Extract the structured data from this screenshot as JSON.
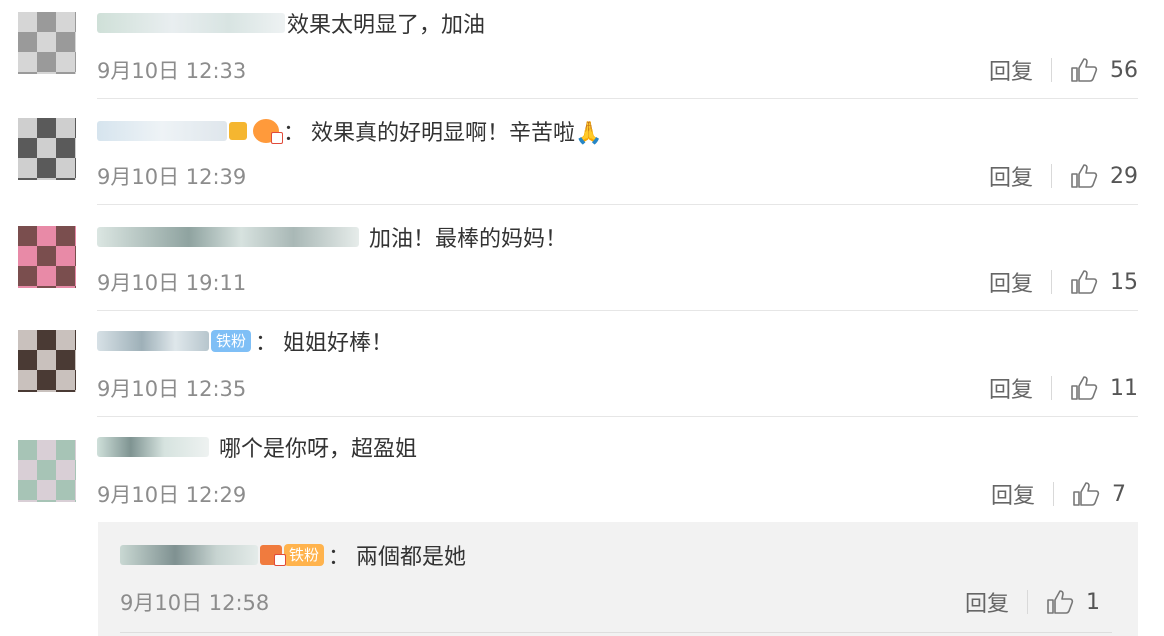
{
  "comments": [
    {
      "text": "效果太明显了，加油",
      "time": "9月10日 12:33",
      "reply": "回复",
      "likes": "56"
    },
    {
      "text": "效果真的好明显啊！辛苦啦🙏",
      "time": "9月10日 12:39",
      "reply": "回复",
      "likes": "29"
    },
    {
      "text": "加油！最棒的妈妈！",
      "time": "9月10日 19:11",
      "reply": "回复",
      "likes": "15"
    },
    {
      "text": "姐姐好棒！",
      "badge": "铁粉",
      "time": "9月10日 12:35",
      "reply": "回复",
      "likes": "11"
    },
    {
      "text": "哪个是你呀，超盈姐",
      "time": "9月10日 12:29",
      "reply": "回复",
      "likes": "7"
    }
  ],
  "sub_reply": {
    "text": "兩個都是她",
    "badge": "铁粉",
    "time": "9月10日 12:58",
    "reply": "回复",
    "likes": "1"
  },
  "colors": {
    "accent_badge": "#7fbff6",
    "orange_badge": "#ffb34d",
    "time": "#8c8c8c"
  }
}
